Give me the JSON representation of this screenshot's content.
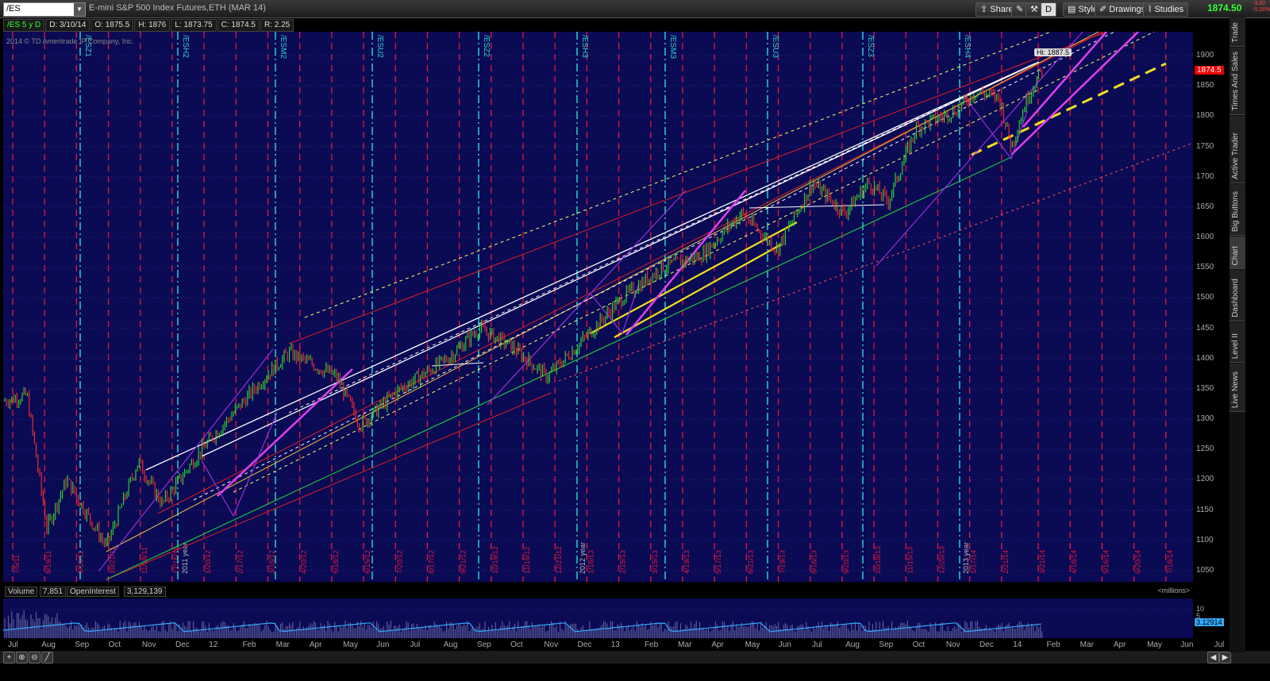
{
  "toolbar": {
    "symbol": "/ES",
    "description": "E-mini S&P 500 Index Futures,ETH (MAR 14)",
    "share_label": "Share",
    "d_label": "D",
    "style_label": "Style",
    "drawings_label": "Drawings",
    "studies_label": "Studies",
    "last_price": "1874.50",
    "change_abs": "-3.00",
    "change_pct": "-0.16%"
  },
  "info": {
    "period": "/ES 5 y D",
    "date": "D: 3/10/14",
    "open": "O: 1875.5",
    "high": "H: 1876",
    "low": "L: 1873.75",
    "close": "C: 1874.5",
    "range": "R: 2.25"
  },
  "copyright": "2014 © TD Ameritrade IP Company, Inc.",
  "price_tag": "1874.5",
  "hi_label": "Hi: 1887.5",
  "price_axis": [
    "1900",
    "1850",
    "1800",
    "1750",
    "1700",
    "1650",
    "1600",
    "1550",
    "1500",
    "1450",
    "1400",
    "1350",
    "1300",
    "1250",
    "1200",
    "1150",
    "1100",
    "1050"
  ],
  "contract_labels": [
    "/ESZ1",
    "/ESH2",
    "/ESM2",
    "/ESU2",
    "/ESZ2",
    "/ESH3",
    "/ESM3",
    "/ESU3",
    "/ESZ3",
    "/ESH4"
  ],
  "date_labels": [
    "7/5/11",
    "8/19/11",
    "9/16/11",
    "10/21/11",
    "11/18/11",
    "12/16/11",
    "1/20/12",
    "2/17/12",
    "3/16/12",
    "4/20/12",
    "5/18/12",
    "6/15/12",
    "7/20/12",
    "8/17/12",
    "9/21/12",
    "10/19/12",
    "11/16/12",
    "12/21/12",
    "1/18/13",
    "2/15/13",
    "3/15/13",
    "4/19/13",
    "5/17/13",
    "6/21/13",
    "7/19/13",
    "8/16/13",
    "9/20/13",
    "10/18/13",
    "11/15/13",
    "12/20/13",
    "1/17/14",
    "2/21/14",
    "3/21/14",
    "4/18/14",
    "5/16/14",
    "6/20/14",
    "7/18/14"
  ],
  "year_labels": [
    "2011 year",
    "2012 year",
    "2013 year"
  ],
  "volume": {
    "volume_label": "Volume",
    "volume_value": "7,851",
    "oi_label": "OpenInterest",
    "oi_value": "3,129,139",
    "millions": "<millions>",
    "axis": [
      "10",
      "5"
    ],
    "oi_tag": "3.12914"
  },
  "x_axis": [
    "Jul",
    "Aug",
    "Sep",
    "Oct",
    "Nov",
    "Dec",
    "12",
    "Feb",
    "Mar",
    "Apr",
    "May",
    "Jun",
    "Jul",
    "Aug",
    "Sep",
    "Oct",
    "Nov",
    "Dec",
    "13",
    "Feb",
    "Mar",
    "Apr",
    "May",
    "Jun",
    "Jul",
    "Aug",
    "Sep",
    "Oct",
    "Nov",
    "Dec",
    "14",
    "Feb",
    "Mar",
    "Apr",
    "May",
    "Jun",
    "Jul"
  ],
  "side_tabs": [
    "Trade",
    "Times And Sales",
    "Active Trader",
    "Big Buttons",
    "Chart",
    "Dashboard",
    "Level II",
    "Live News"
  ],
  "colors": {
    "chart_bg": "#0a0a55",
    "up_bar": "#2ee02e",
    "down_bar": "#ff2d2d",
    "red_grid": "#e01a3a",
    "cyan_grid": "#2ad0d0",
    "magenta": "#e040f0",
    "yellow": "#f0e020"
  }
}
